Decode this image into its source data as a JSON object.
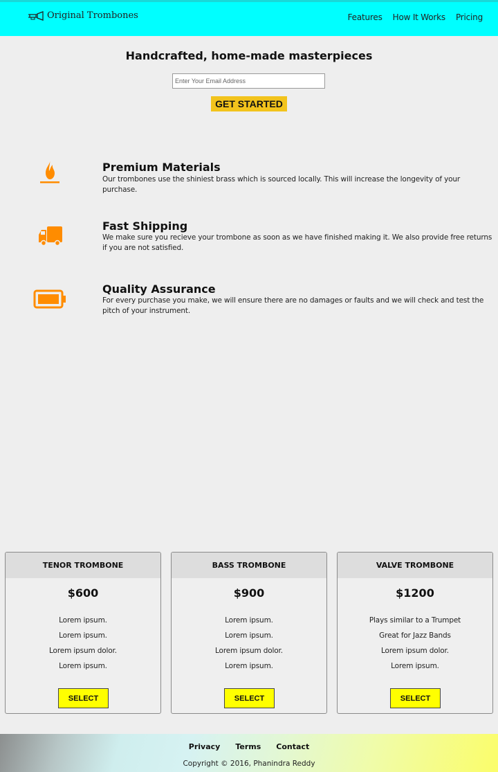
{
  "header": {
    "logo_text": "Original Trombones",
    "logo_icon": "trombone-icon",
    "nav": [
      "Features",
      "How It Works",
      "Pricing"
    ]
  },
  "hero": {
    "title": "Handcrafted, home-made masterpieces",
    "email_placeholder": "Enter Your Email Address",
    "cta_label": "GET STARTED"
  },
  "features": [
    {
      "icon": "fire-icon",
      "title": "Premium Materials",
      "description": "Our trombones use the shiniest brass which is sourced locally. This will increase the longevity of your purchase."
    },
    {
      "icon": "truck-icon",
      "title": "Fast Shipping",
      "description": "We make sure you recieve your trombone as soon as we have finished making it. We also provide free returns if you are not satisfied."
    },
    {
      "icon": "battery-full-icon",
      "title": "Quality Assurance",
      "description": "For every purchase you make, we will ensure there are no damages or faults and we will check and test the pitch of your instrument."
    }
  ],
  "pricing": [
    {
      "name": "TENOR TROMBONE",
      "price": "$600",
      "features": [
        "Lorem ipsum.",
        "Lorem ipsum.",
        "Lorem ipsum dolor.",
        "Lorem ipsum."
      ],
      "button": "SELECT"
    },
    {
      "name": "BASS TROMBONE",
      "price": "$900",
      "features": [
        "Lorem ipsum.",
        "Lorem ipsum.",
        "Lorem ipsum dolor.",
        "Lorem ipsum."
      ],
      "button": "SELECT"
    },
    {
      "name": "VALVE TROMBONE",
      "price": "$1200",
      "features": [
        "Plays similar to a Trumpet",
        "Great for Jazz Bands",
        "Lorem ipsum dolor.",
        "Lorem ipsum."
      ],
      "button": "SELECT"
    }
  ],
  "footer": {
    "links": [
      "Privacy",
      "Terms",
      "Contact"
    ],
    "copyright": "Copyright © 2016, Phanindra Reddy"
  },
  "colors": {
    "header_bg": "#00ffff",
    "accent_orange": "#ff8c00",
    "cta_yellow": "#f2c31c",
    "select_yellow": "#ffff00"
  }
}
